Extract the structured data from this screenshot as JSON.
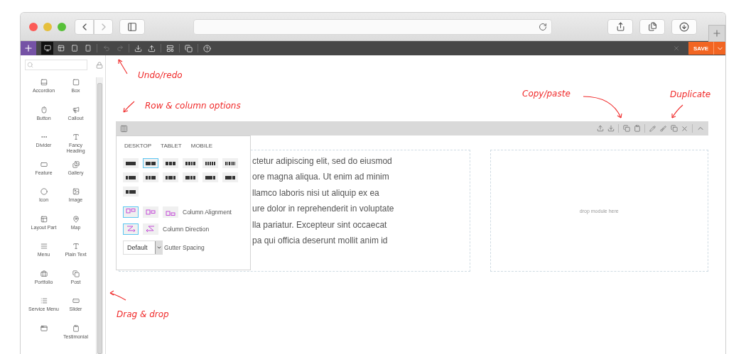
{
  "toolbar": {
    "devices": [
      {
        "selected": true
      },
      {
        "selected": false
      },
      {
        "selected": false
      },
      {
        "selected": false
      }
    ],
    "history": [
      {
        "disabled": true
      },
      {
        "disabled": true
      }
    ],
    "save": "SAVE"
  },
  "sidebar": {
    "modules": [
      {
        "kind": "labeled",
        "label": "Accordion"
      },
      {
        "kind": "labeled",
        "label": "Box"
      },
      {
        "kind": "labeled",
        "label": "Button"
      },
      {
        "kind": "labeled",
        "label": "Callout"
      },
      {
        "kind": "labeled",
        "label": "Divider"
      },
      {
        "kind": "labeled",
        "label": "Fancy Heading"
      },
      {
        "kind": "labeled",
        "label": "Feature"
      },
      {
        "kind": "labeled",
        "label": "Gallery"
      },
      {
        "kind": "labeled",
        "label": "Icon"
      },
      {
        "kind": "labeled",
        "label": "Image"
      },
      {
        "kind": "labeled",
        "label": "Layout Part"
      },
      {
        "kind": "labeled",
        "label": "Map"
      },
      {
        "kind": "labeled",
        "label": "Menu"
      },
      {
        "kind": "labeled",
        "label": "Plain Text"
      },
      {
        "kind": "labeled",
        "label": "Portfolio"
      },
      {
        "kind": "labeled",
        "label": "Post"
      },
      {
        "kind": "labeled",
        "label": "Service Menu"
      },
      {
        "kind": "labeled",
        "label": "Slider"
      },
      {
        "kind": "icon_only"
      },
      {
        "kind": "labeled",
        "label": "Testimonial"
      }
    ]
  },
  "annotations": [
    {
      "text": "Undo/redo"
    },
    {
      "text": "Row & column options"
    },
    {
      "text": "Copy/paste"
    },
    {
      "text": "Duplicate"
    },
    {
      "text": "Drag & drop"
    }
  ],
  "row": {
    "columns": [
      {
        "text_lines": [
          "ctetur adipiscing elit, sed do eiusmod",
          "ore magna aliqua. Ut enim ad minim",
          "llamco laboris nisi ut aliquip ex ea",
          "ure dolor in reprehenderit in voluptate",
          "lla pariatur. Excepteur sint occaecat",
          "pa qui officia deserunt mollit anim id"
        ]
      },
      {
        "drop_hint": "drop module here"
      }
    ]
  },
  "row_options": {
    "tabs": [
      {
        "label": "DESKTOP",
        "selected": false
      },
      {
        "label": "TABLET",
        "selected": false
      },
      {
        "label": "MOBILE",
        "selected": false
      }
    ],
    "layouts": [
      {
        "selected": false
      },
      {
        "selected": true
      },
      {
        "selected": false
      },
      {
        "selected": false
      },
      {
        "selected": false
      },
      {
        "selected": false
      },
      {
        "selected": false
      },
      {
        "selected": false
      },
      {
        "selected": false
      },
      {
        "selected": false
      },
      {
        "selected": false
      },
      {
        "selected": false
      },
      {
        "selected": false
      }
    ],
    "alignment": {
      "label": "Column Alignment",
      "options": [
        {
          "selected": true
        },
        {
          "selected": false
        },
        {
          "selected": false
        }
      ]
    },
    "direction": {
      "label": "Column Direction",
      "options": [
        {
          "selected": true
        },
        {
          "selected": false
        }
      ]
    },
    "gutter": {
      "value": "Default",
      "label": "Gutter Spacing"
    }
  }
}
